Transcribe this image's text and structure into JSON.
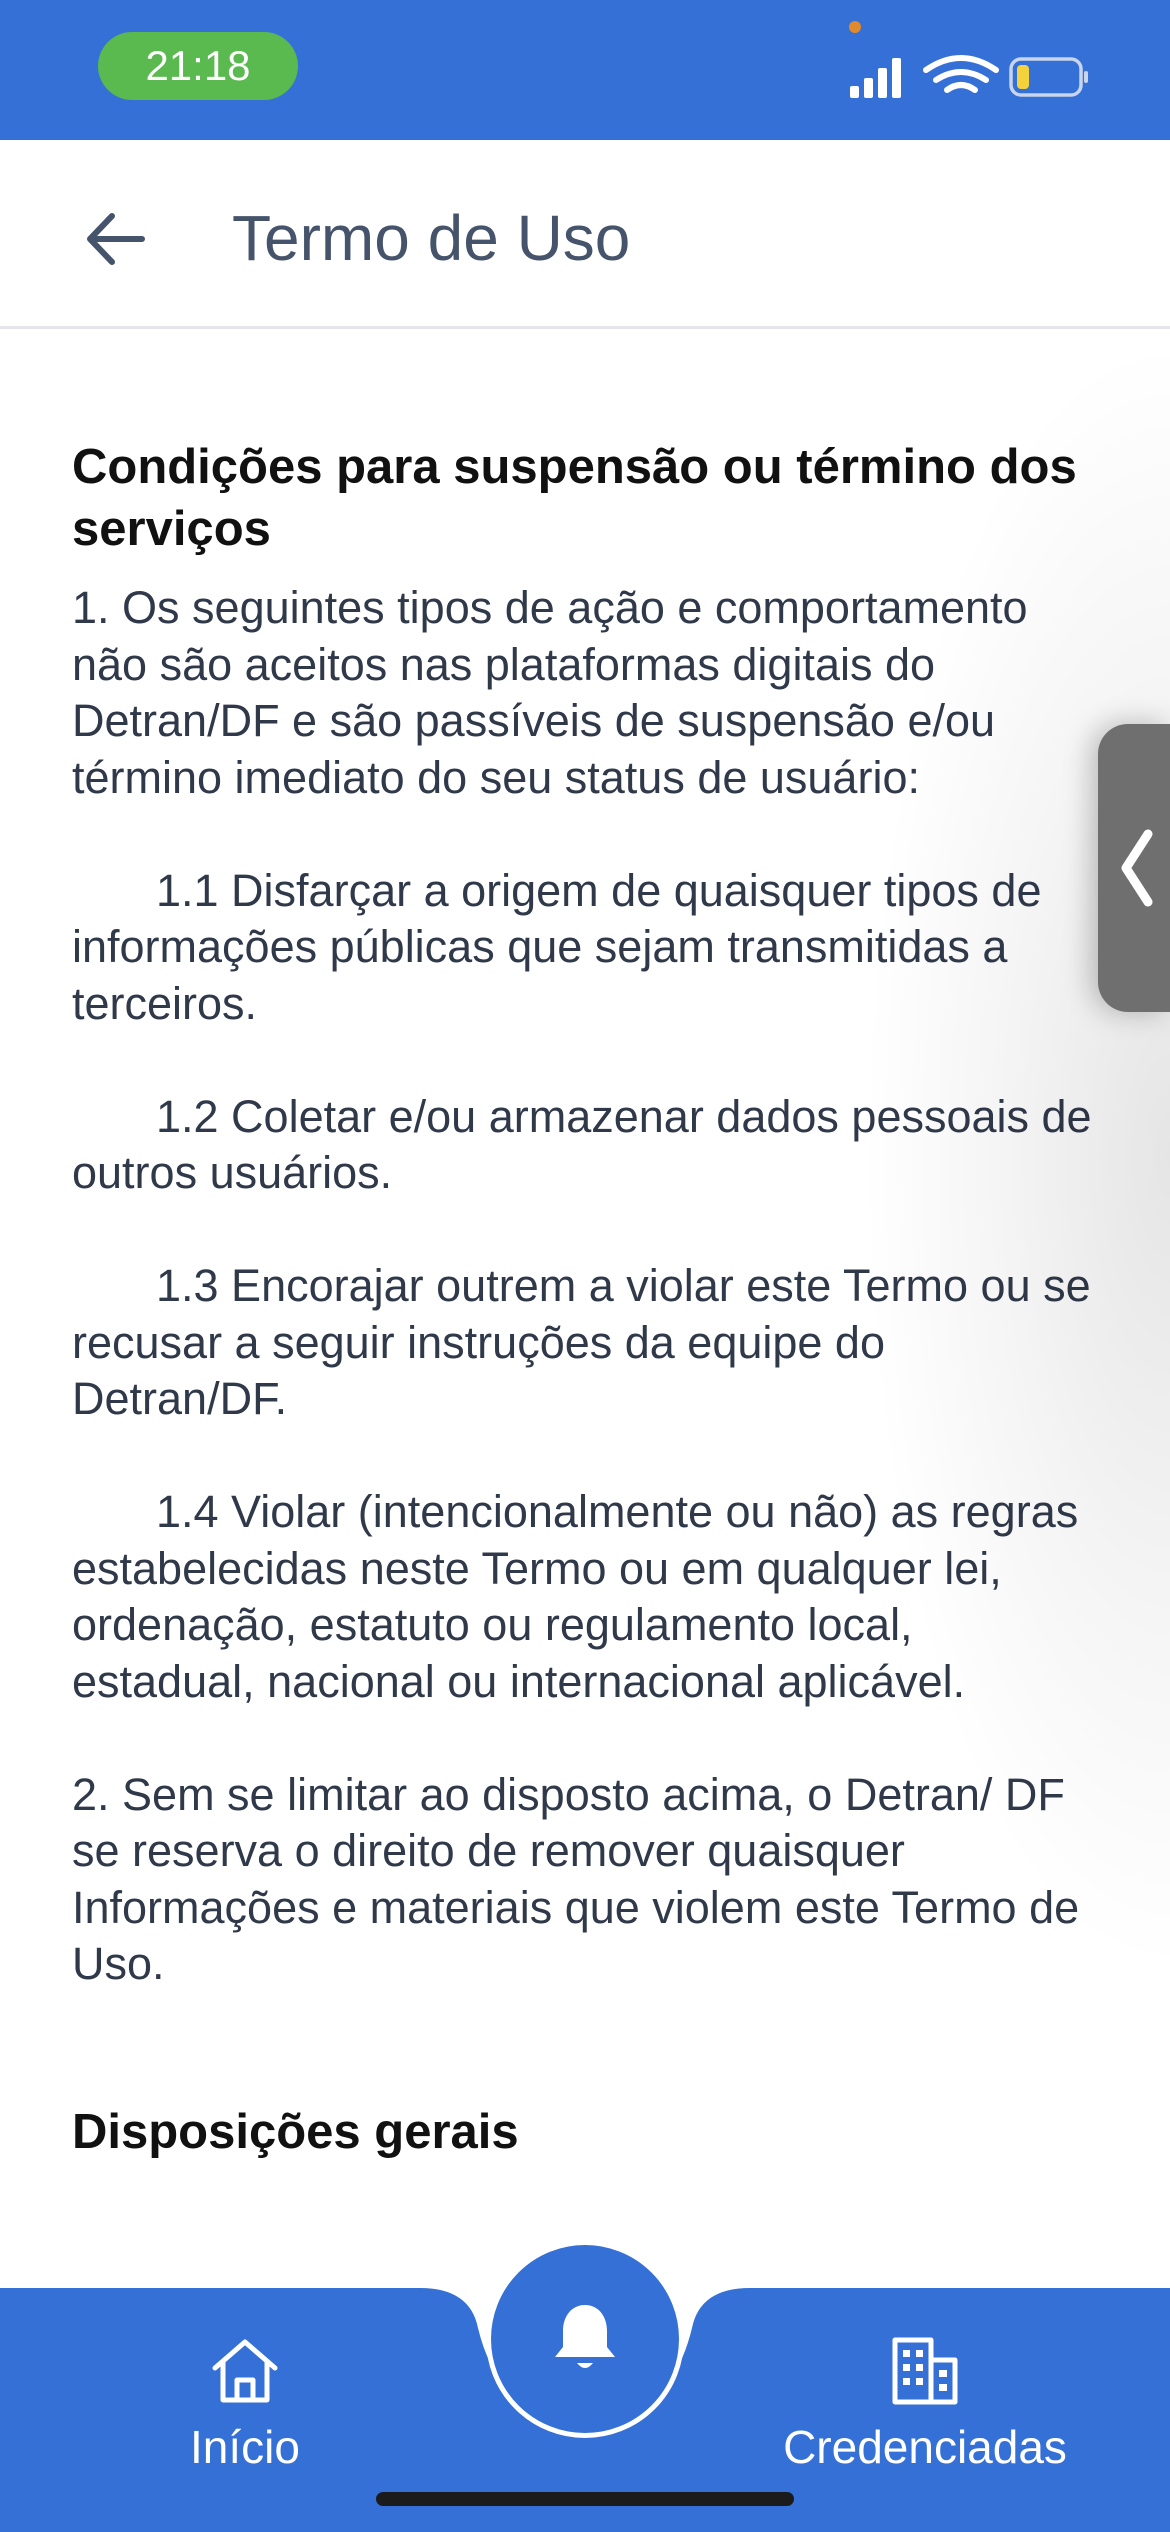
{
  "status_bar": {
    "time": "21:18"
  },
  "header": {
    "title": "Termo de Uso"
  },
  "content": {
    "section1_title": "Condições para suspensão ou término dos serviços",
    "p1": "1. Os seguintes tipos de ação e comportamento não são aceitos nas plataformas digitais do Detran/DF e são passíveis de suspensão e/ou término imediato do seu status de usuário:",
    "p1_1": "1.1 Disfarçar a origem de quaisquer tipos de informações públicas que sejam transmitidas a terceiros.",
    "p1_2": "1.2 Coletar e/ou armazenar dados pessoais de outros usuários.",
    "p1_3": "1.3 Encorajar outrem a violar este Termo ou se recusar a seguir instruções da equipe do Detran/DF.",
    "p1_4": "1.4 Violar (intencionalmente ou não) as regras estabelecidas neste Termo ou em qualquer lei, ordenação, estatuto ou regulamento local, estadual, nacional ou internacional aplicável.",
    "p2": "2. Sem se limitar ao disposto acima, o Detran/ DF se reserva o direito de remover quaisquer Informações e materiais que violem este Termo de Uso.",
    "section2_title": "Disposições gerais"
  },
  "bottom_nav": {
    "home_label": "Início",
    "accredited_label": "Credenciadas"
  },
  "colors": {
    "primary": "#3570d6",
    "time_pill": "#5ab94f",
    "title_text": "#46546b",
    "body_text": "#30394a"
  }
}
